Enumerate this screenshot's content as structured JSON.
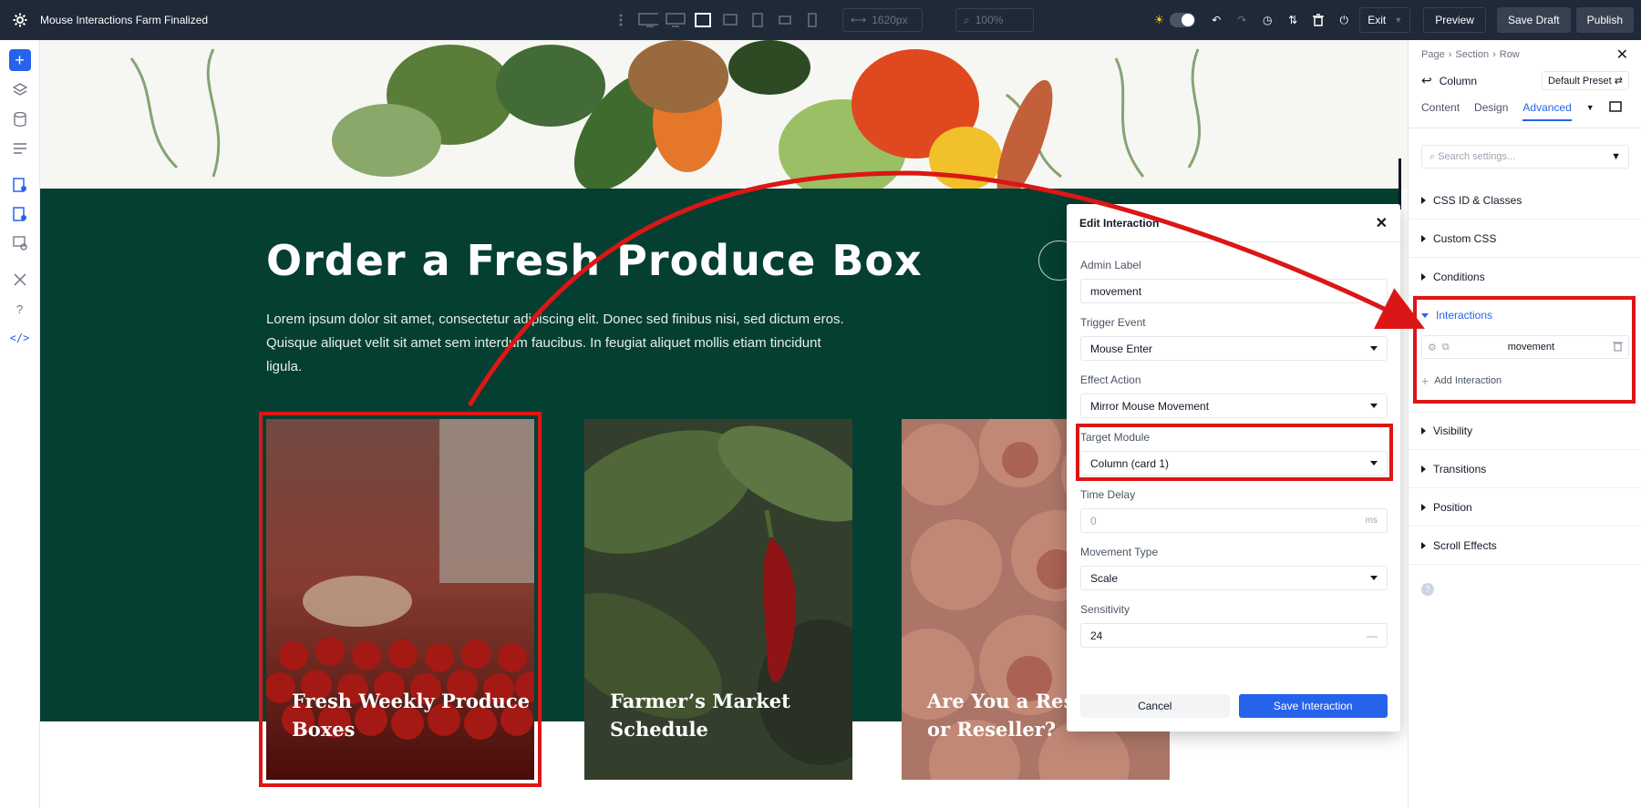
{
  "topbar": {
    "title": "Mouse Interactions  Farm Finalized",
    "width_value": "1620px",
    "zoom_value": "100%",
    "exit_label": "Exit",
    "preview_label": "Preview",
    "save_draft_label": "Save Draft",
    "publish_label": "Publish"
  },
  "canvas": {
    "heading": "Order a Fresh Produce Box",
    "lede": "Lorem ipsum dolor sit amet, consectetur adipiscing elit. Donec sed finibus nisi, sed dictum eros. Quisque aliquet velit sit amet sem interdum faucibus. In feugiat aliquet mollis etiam tincidunt ligula.",
    "cards": [
      {
        "title": "Fresh Weekly Produce\nBoxes"
      },
      {
        "title": "Farmer’s Market\nSchedule"
      },
      {
        "title": "Are You a Restaurant\nor Reseller?"
      }
    ]
  },
  "modal": {
    "title": "Edit Interaction",
    "fields": {
      "admin_label": {
        "label": "Admin Label",
        "value": "movement"
      },
      "trigger_event": {
        "label": "Trigger Event",
        "value": "Mouse Enter"
      },
      "effect_action": {
        "label": "Effect Action",
        "value": "Mirror Mouse Movement"
      },
      "target_module": {
        "label": "Target Module",
        "value": "Column (card 1)"
      },
      "time_delay": {
        "label": "Time Delay",
        "value": "0",
        "unit": "ms"
      },
      "movement_type": {
        "label": "Movement Type",
        "value": "Scale"
      },
      "sensitivity": {
        "label": "Sensitivity",
        "value": "24",
        "unit": "—"
      }
    },
    "cancel_label": "Cancel",
    "save_label": "Save Interaction"
  },
  "panel": {
    "breadcrumb": [
      "Page",
      "›",
      "Section",
      "›",
      "Row"
    ],
    "element_title": "Column",
    "preset_label": "Default Preset",
    "tabs": [
      "Content",
      "Design",
      "Advanced"
    ],
    "search_placeholder": "Search settings...",
    "sections": {
      "css": "CSS ID & Classes",
      "custom_css": "Custom CSS",
      "conditions": "Conditions",
      "interactions": "Interactions",
      "visibility": "Visibility",
      "transitions": "Transitions",
      "position": "Position",
      "scroll_effects": "Scroll Effects"
    },
    "interaction_item": "movement",
    "add_interaction": "Add Interaction"
  },
  "colors": {
    "accent": "#2563eb",
    "highlight": "#dc1616",
    "section_green": "#053f32",
    "topbar": "#1f2937"
  }
}
